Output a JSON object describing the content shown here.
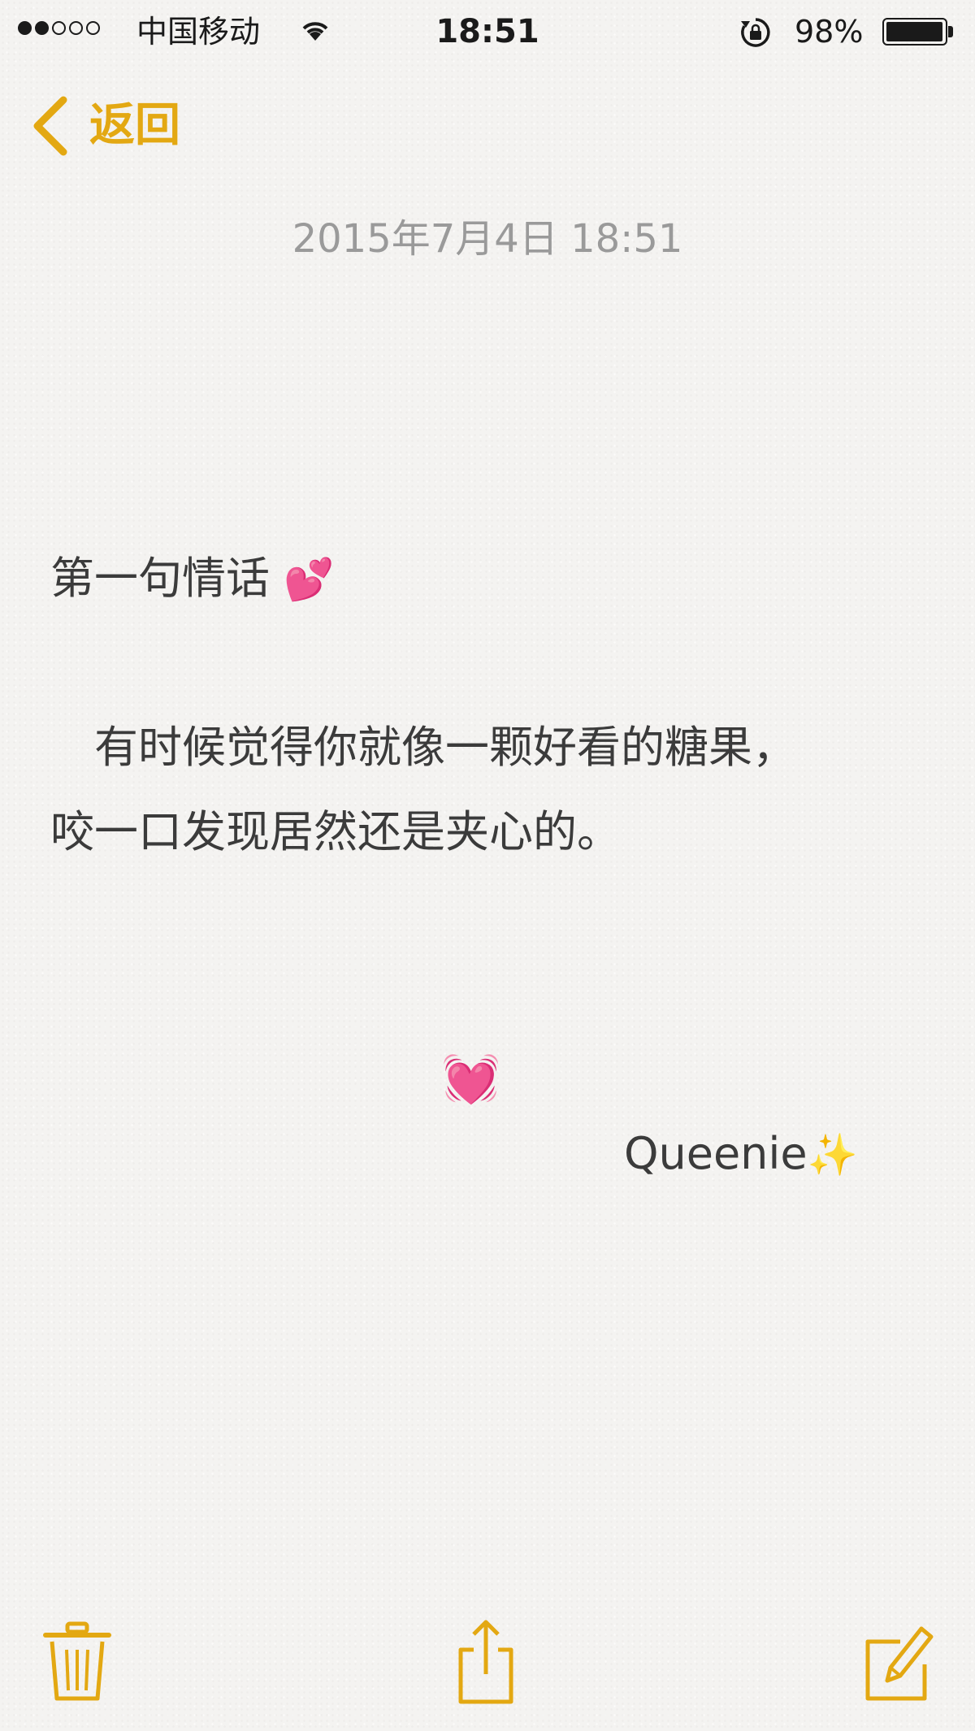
{
  "status_bar": {
    "signal_bars_filled": 2,
    "signal_bars_total": 5,
    "carrier": "中国移动",
    "time": "18:51",
    "battery_percent": "98%",
    "battery_level": 0.98
  },
  "nav": {
    "back_label": "返回"
  },
  "note": {
    "date": "2015年7月4日 18:51",
    "title": "第一句情话",
    "title_emoji": "💕",
    "line1": "　有时候觉得你就像一颗好看的糖果，",
    "line2": "咬一口发现居然还是夹心的。",
    "heart_emoji": "💓",
    "signature": "Queenie",
    "signature_emoji": "✨"
  },
  "toolbar": {
    "trash_icon": "trash-icon",
    "share_icon": "share-icon",
    "compose_icon": "compose-icon"
  },
  "colors": {
    "accent": "#e3a812",
    "date_text": "#9a9a9a",
    "body_text": "#3b3b3b"
  }
}
